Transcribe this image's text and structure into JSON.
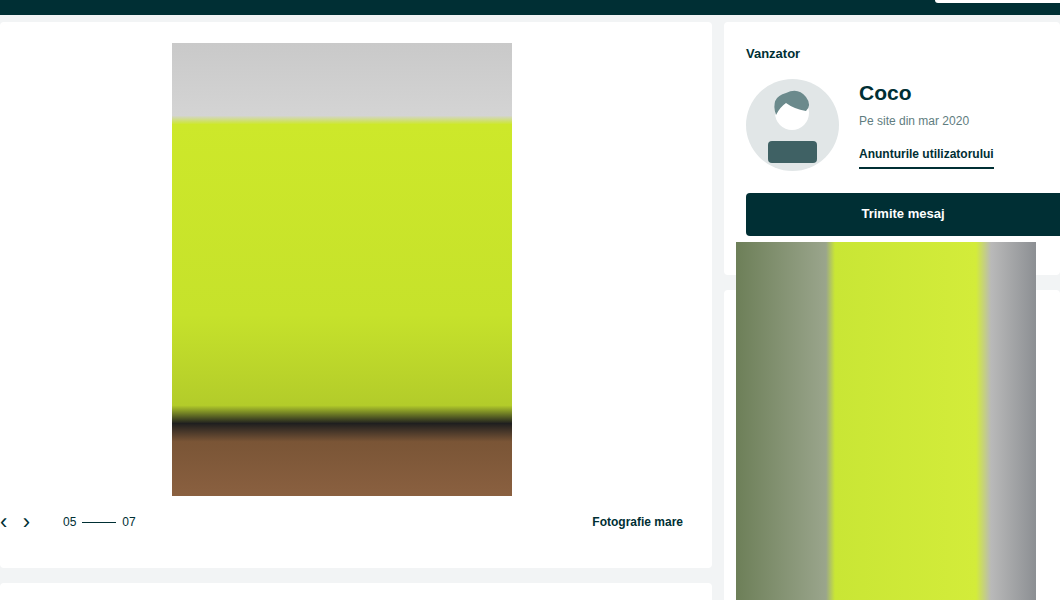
{
  "gallery": {
    "prev": "‹",
    "next": "›",
    "current": "05",
    "total": "07",
    "large_photo": "Fotografie mare"
  },
  "seller": {
    "heading": "Vanzator",
    "name": "Coco",
    "since": "Pe site din mar 2020",
    "ads_link": "Anunturile utilizatorului",
    "message_button": "Trimite mesaj"
  }
}
